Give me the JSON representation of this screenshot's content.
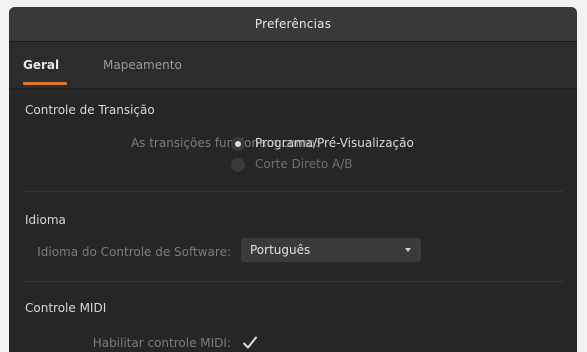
{
  "window": {
    "title": "Preferências"
  },
  "tabs": [
    {
      "label": "Geral",
      "active": true
    },
    {
      "label": "Mapeamento",
      "active": false
    }
  ],
  "transition": {
    "section_title": "Controle de Transição",
    "label": "As transições funcionam como:",
    "options": [
      {
        "label": "Programa/Pré-Visualização",
        "selected": true
      },
      {
        "label": "Corte Direto A/B",
        "selected": false
      }
    ]
  },
  "language": {
    "section_title": "Idioma",
    "label": "Idioma do Controle de Software:",
    "selected_value": "Português",
    "dropdown_icon": "chevron-down-icon"
  },
  "midi": {
    "section_title": "Controle MIDI",
    "enable_label": "Habilitar controle MIDI:",
    "enabled": true,
    "check_icon": "checkmark-icon"
  },
  "colors": {
    "accent": "#e0762a",
    "background": "#262626",
    "titlebar": "#393939"
  }
}
